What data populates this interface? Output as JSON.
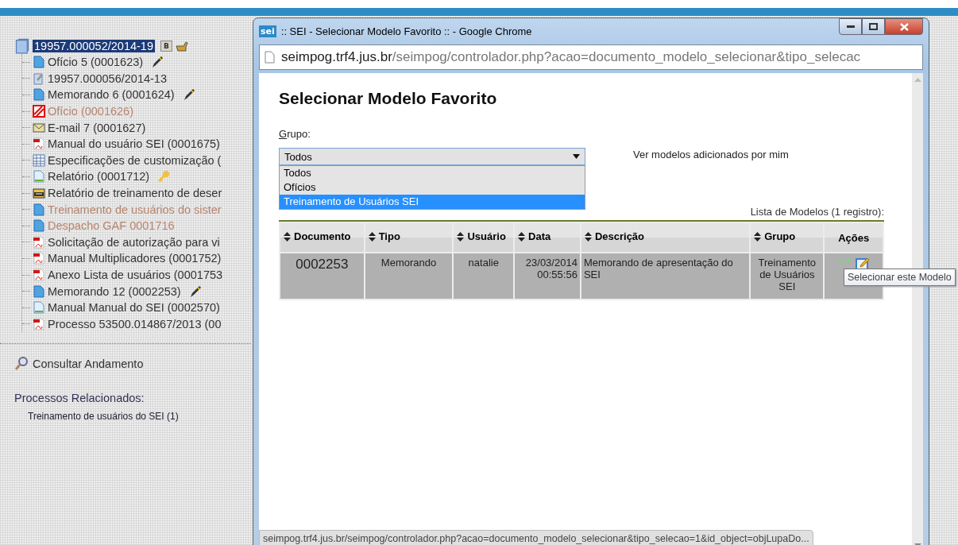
{
  "process_tree": {
    "root": {
      "label": "19957.000052/2014-19",
      "selected": true,
      "badge": "B"
    },
    "children": [
      {
        "label": "Ofício 5 (0001623)",
        "kind": "doc",
        "signed": true,
        "restricted": false,
        "muted": false
      },
      {
        "label": "19957.000056/2014-13",
        "kind": "process",
        "signed": false,
        "restricted": false,
        "muted": false
      },
      {
        "label": "Memorando 6 (0001624)",
        "kind": "doc",
        "signed": true,
        "restricted": false,
        "muted": false
      },
      {
        "label": "Ofício (0001626)",
        "kind": "canceled",
        "signed": false,
        "restricted": false,
        "muted": true
      },
      {
        "label": "E-mail 7 (0001627)",
        "kind": "email",
        "signed": false,
        "restricted": false,
        "muted": false
      },
      {
        "label": "Manual do usuário SEI (0001675)",
        "kind": "pdf",
        "signed": false,
        "restricted": false,
        "muted": false
      },
      {
        "label": "Especificações de customização (",
        "kind": "sheet",
        "signed": false,
        "restricted": false,
        "muted": false
      },
      {
        "label": "Relatório (0001712)",
        "kind": "form",
        "signed": false,
        "restricted": true,
        "muted": false
      },
      {
        "label": "Relatório de treinamento de deser",
        "kind": "zip",
        "signed": false,
        "restricted": false,
        "muted": false
      },
      {
        "label": "Treinamento de usuários do sister",
        "kind": "doc",
        "signed": false,
        "restricted": false,
        "muted": true
      },
      {
        "label": "Despacho GAF 0001716",
        "kind": "doc",
        "signed": false,
        "restricted": false,
        "muted": true
      },
      {
        "label": "Solicitação de autorização para vi",
        "kind": "pdf",
        "signed": false,
        "restricted": false,
        "muted": false
      },
      {
        "label": "Manual Multiplicadores (0001752)",
        "kind": "pdf",
        "signed": false,
        "restricted": false,
        "muted": false
      },
      {
        "label": "Anexo Lista de usuários (0001753",
        "kind": "pdf",
        "signed": false,
        "restricted": false,
        "muted": false
      },
      {
        "label": "Memorando 12 (0002253)",
        "kind": "doc",
        "signed": true,
        "restricted": false,
        "muted": false
      },
      {
        "label": "Manual Manual do SEI (0002570)",
        "kind": "form",
        "signed": false,
        "restricted": false,
        "muted": false
      },
      {
        "label": "Processo 53500.014867/2013 (00",
        "kind": "pdf",
        "signed": false,
        "restricted": false,
        "muted": false
      }
    ]
  },
  "consult_link": "Consultar Andamento",
  "related": {
    "title": "Processos Relacionados:",
    "items": [
      "Treinamento de usuários do SEI (1)"
    ]
  },
  "popup": {
    "logo": "sei",
    "title": ":: SEI - Selecionar Modelo Favorito :: - Google Chrome",
    "address": {
      "host": "seimpog.trf4.jus.br",
      "path": "/seimpog/controlador.php?acao=documento_modelo_selecionar&tipo_selecac"
    },
    "heading": "Selecionar Modelo Favorito",
    "group_label": "Grupo:",
    "group_select": {
      "value": "Todos",
      "open": true,
      "options": [
        {
          "label": "Todos",
          "highlighted": false
        },
        {
          "label": "Ofícios",
          "highlighted": false
        },
        {
          "label": "Treinamento de Usuários SEI",
          "highlighted": true
        }
      ]
    },
    "my_models_link": "Ver modelos adicionados por mim",
    "table": {
      "caption": "Lista de Modelos (1 registro):",
      "columns": [
        {
          "label": "Documento",
          "sortable": true
        },
        {
          "label": "Tipo",
          "sortable": true
        },
        {
          "label": "Usuário",
          "sortable": true
        },
        {
          "label": "Data",
          "sortable": true
        },
        {
          "label": "Descrição",
          "sortable": true
        },
        {
          "label": "Grupo",
          "sortable": true
        },
        {
          "label": "Ações",
          "sortable": false
        }
      ],
      "rows": [
        {
          "cells": [
            "0002253",
            "Memorando",
            "natalie",
            "23/03/2014 00:55:56",
            "Memorando de apresentação do SEI",
            "Treinamento de Usuários SEI"
          ]
        }
      ]
    },
    "tooltip": "Selecionar este Modelo",
    "status_url": "seimpog.trf4.jus.br/seimpog/controlador.php?acao=documento_modelo_selecionar&tipo_selecao=1&id_object=objLupaDo..."
  }
}
